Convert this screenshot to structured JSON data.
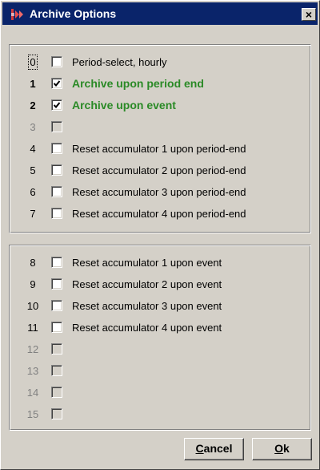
{
  "window": {
    "title": "Archive Options"
  },
  "group1": [
    {
      "num": "0",
      "label": "Period-select, hourly",
      "checked": false,
      "enabled": true,
      "focused": true
    },
    {
      "num": "1",
      "label": "Archive upon period end",
      "checked": true,
      "enabled": true
    },
    {
      "num": "2",
      "label": "Archive upon event",
      "checked": true,
      "enabled": true
    },
    {
      "num": "3",
      "label": "",
      "checked": false,
      "enabled": false
    },
    {
      "num": "4",
      "label": "Reset accumulator 1 upon period-end",
      "checked": false,
      "enabled": true
    },
    {
      "num": "5",
      "label": "Reset accumulator 2 upon period-end",
      "checked": false,
      "enabled": true
    },
    {
      "num": "6",
      "label": "Reset accumulator 3 upon period-end",
      "checked": false,
      "enabled": true
    },
    {
      "num": "7",
      "label": "Reset accumulator 4 upon period-end",
      "checked": false,
      "enabled": true
    }
  ],
  "group2": [
    {
      "num": "8",
      "label": "Reset accumulator 1 upon event",
      "checked": false,
      "enabled": true
    },
    {
      "num": "9",
      "label": "Reset accumulator 2 upon event",
      "checked": false,
      "enabled": true
    },
    {
      "num": "10",
      "label": "Reset accumulator 3 upon event",
      "checked": false,
      "enabled": true
    },
    {
      "num": "11",
      "label": "Reset accumulator 4 upon event",
      "checked": false,
      "enabled": true
    },
    {
      "num": "12",
      "label": "",
      "checked": false,
      "enabled": false
    },
    {
      "num": "13",
      "label": "",
      "checked": false,
      "enabled": false
    },
    {
      "num": "14",
      "label": "",
      "checked": false,
      "enabled": false
    },
    {
      "num": "15",
      "label": "",
      "checked": false,
      "enabled": false
    }
  ],
  "buttons": {
    "cancel": {
      "first": "C",
      "rest": "ancel"
    },
    "ok": {
      "first": "O",
      "rest": "k"
    }
  },
  "icons": {
    "app": "archive-app-icon",
    "close": "close-icon",
    "check": "check-icon"
  },
  "colors": {
    "titlebar": "#0a246a",
    "checked_label": "#2a8a26",
    "dialog": "#d4d0c8"
  }
}
